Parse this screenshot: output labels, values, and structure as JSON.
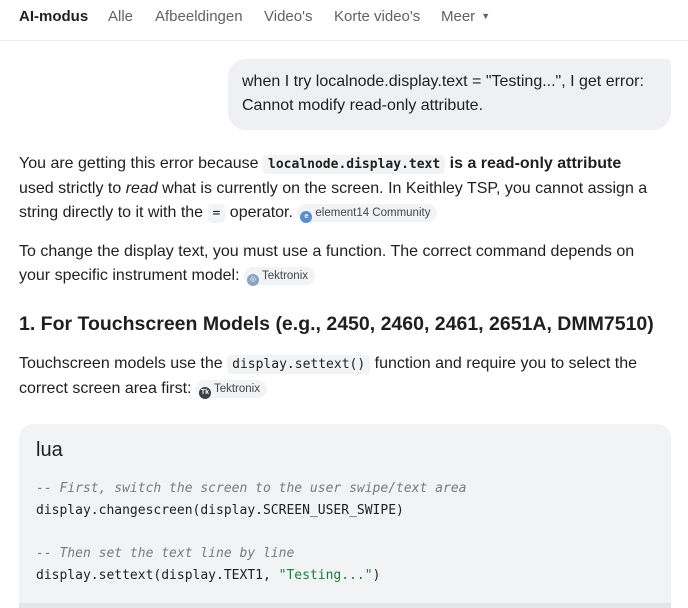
{
  "tabs": [
    {
      "label": "AI-modus",
      "active": true
    },
    {
      "label": "Alle"
    },
    {
      "label": "Afbeeldingen"
    },
    {
      "label": "Video's"
    },
    {
      "label": "Korte video's"
    },
    {
      "label": "Meer",
      "dropdown": true
    }
  ],
  "user_message": {
    "line1": "when I try localnode.display.text = \"Testing...\", I get error:",
    "line2": "Cannot modify read-only attribute."
  },
  "answer": {
    "p1": {
      "t1": "You are getting this error because ",
      "code": "localnode.display.text",
      "t2": " is a read-only attribute",
      "t3": "used strictly to ",
      "t4": "read",
      "t5": " what is currently on the screen. In Keithley TSP, you cannot assign a",
      "t6": "string directly to it with the ",
      "code2": "=",
      "t7": " operator.",
      "chip": "element14 Community"
    },
    "p2": {
      "t1": "To change the display text, you must use a function. The correct command depends on",
      "t2": "your specific instrument model:",
      "chip": "Tektronix"
    },
    "heading": "1. For Touchscreen Models (e.g., 2450, 2460, 2461, 2651A, DMM7510)",
    "p3": {
      "t1": "Touchscreen models use the ",
      "code": "display.settext()",
      "t2": " function and require you to select the",
      "t3": "correct screen area first:",
      "chip": "Tektronix"
    }
  },
  "code_block": {
    "language": "lua",
    "comment1": "-- First, switch the screen to the user swipe/text area",
    "line1": "display.changescreen(display.SCREEN_USER_SWIPE)",
    "comment2": "-- Then set the text line by line",
    "line2_code": "display.settext(display.TEXT1, ",
    "line2_string": "\"Testing...\"",
    "line2_end": ")"
  },
  "icons": {
    "dropdown": "caret-down-icon",
    "chip1": "element14-favicon-icon",
    "chip2": "tektronix-favicon-icon",
    "chip3": "tektronix-favicon-icon"
  },
  "colors": {
    "active_tab": "#1f1f1f",
    "inactive_tab": "#5f6368",
    "bubble_bg": "#eef0f3",
    "code_bg": "#f1f3f4",
    "string": "#188038",
    "comment": "#777b80"
  }
}
